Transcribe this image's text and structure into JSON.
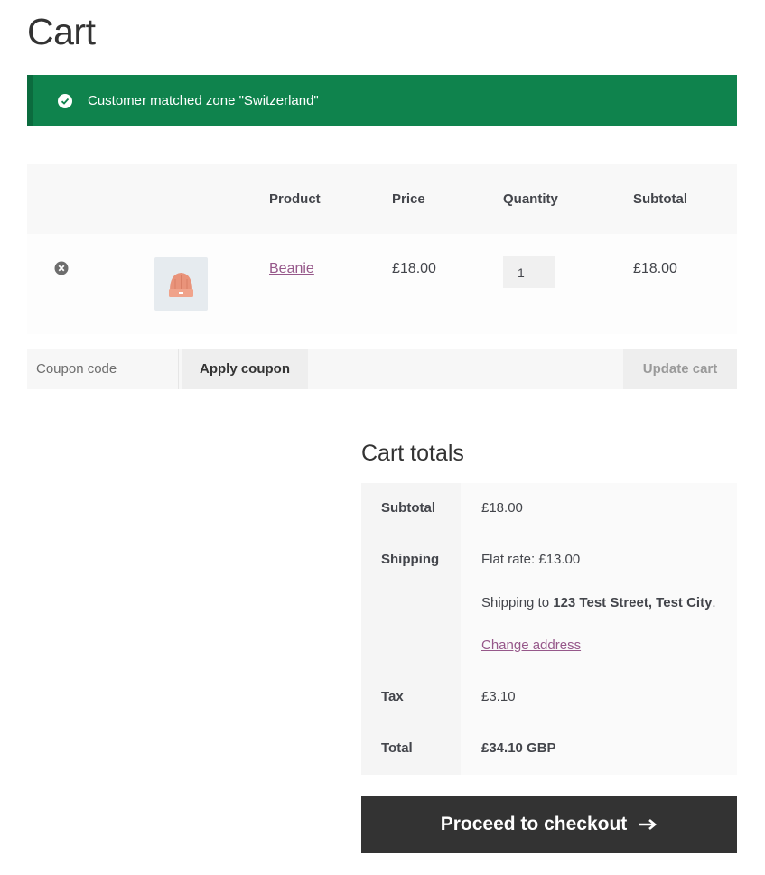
{
  "page": {
    "title": "Cart"
  },
  "notice": {
    "text": "Customer matched zone \"Switzerland\"",
    "color": "#0f834d"
  },
  "cart_table": {
    "headers": [
      "Product",
      "Price",
      "Quantity",
      "Subtotal"
    ],
    "items": [
      {
        "name": "Beanie",
        "price": "£18.00",
        "quantity": "1",
        "subtotal": "£18.00",
        "thumb_icon": "beanie-image"
      }
    ]
  },
  "actions": {
    "coupon_placeholder": "Coupon code",
    "apply_label": "Apply coupon",
    "update_label": "Update cart"
  },
  "totals": {
    "title": "Cart totals",
    "subtotal_label": "Subtotal",
    "subtotal_value": "£18.00",
    "shipping_label": "Shipping",
    "shipping_rate": "Flat rate: £13.00",
    "shipping_to_prefix": "Shipping to ",
    "shipping_address": "123 Test Street, Test City",
    "shipping_to_suffix": ".",
    "change_address": "Change address",
    "tax_label": "Tax",
    "tax_value": "£3.10",
    "total_label": "Total",
    "total_value": "£34.10 GBP"
  },
  "checkout": {
    "label": "Proceed to checkout",
    "icon": "arrow-right-icon"
  }
}
